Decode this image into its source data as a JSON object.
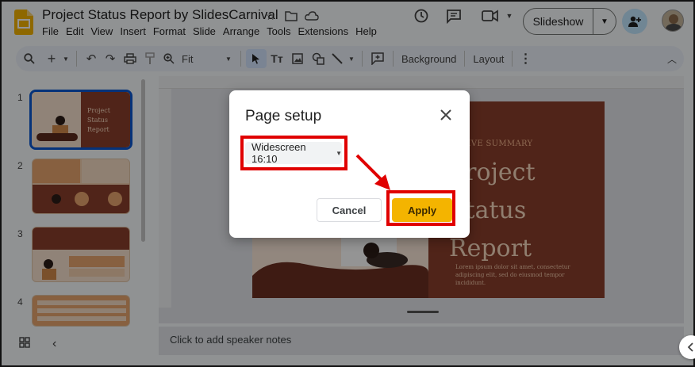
{
  "header": {
    "doc_title": "Project Status Report by SlidesCarnival",
    "menus": [
      "File",
      "Edit",
      "View",
      "Insert",
      "Format",
      "Slide",
      "Arrange",
      "Tools",
      "Extensions",
      "Help"
    ],
    "slideshow_label": "Slideshow"
  },
  "toolbar": {
    "zoom_label": "Fit",
    "background_label": "Background",
    "layout_label": "Layout"
  },
  "filmstrip": {
    "slides": [
      {
        "num": "1",
        "selected": true
      },
      {
        "num": "2",
        "selected": false
      },
      {
        "num": "3",
        "selected": false
      },
      {
        "num": "4",
        "selected": false
      }
    ]
  },
  "slide": {
    "kicker": "CUTIVE SUMMARY",
    "title": "Project Status Report",
    "body": "Lorem ipsum dolor sit amet, consectetur adipiscing elit, sed do eiusmod tempor incididunt."
  },
  "notes": {
    "placeholder": "Click to add speaker notes"
  },
  "dialog": {
    "title": "Page setup",
    "size_value": "Widescreen 16:10",
    "cancel_label": "Cancel",
    "apply_label": "Apply"
  },
  "colors": {
    "highlight": "#e00000",
    "apply_bg": "#f4b400",
    "slide_brown": "#8a3f2c"
  }
}
